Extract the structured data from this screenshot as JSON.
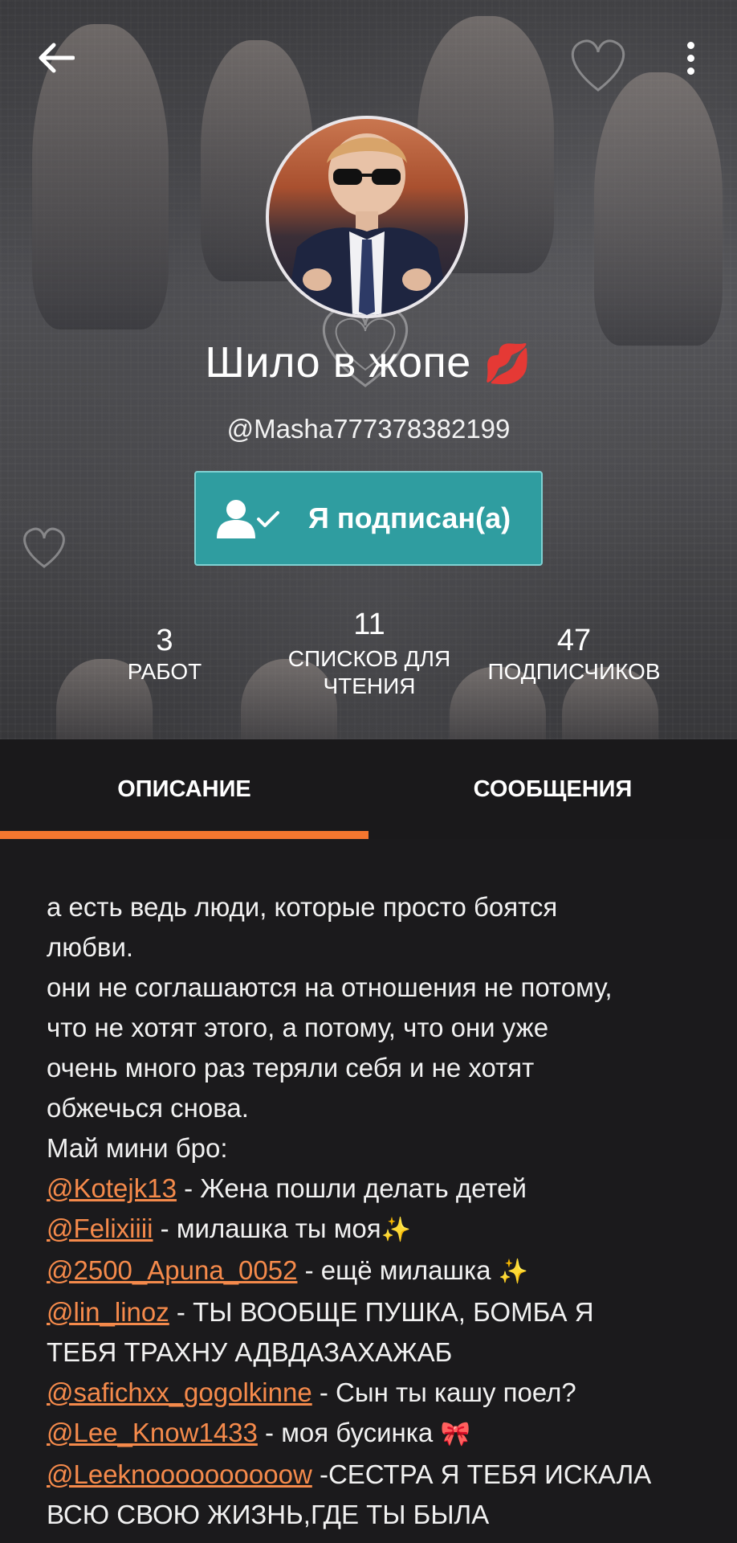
{
  "header": {
    "back_icon": "arrow-left-icon",
    "menu_icon": "more-vertical-icon"
  },
  "profile": {
    "name": "Шило в жопе",
    "name_emoji": "💋",
    "handle": "@Masha777378382199",
    "follow_button_label": "Я подписан(а)",
    "follow_icon": "user-check-icon"
  },
  "stats": [
    {
      "value": "3",
      "label": "РАБОТ"
    },
    {
      "value": "11",
      "label_line1": "СПИСКОВ ДЛЯ",
      "label_line2": "ЧТЕНИЯ"
    },
    {
      "value": "47",
      "label": "ПОДПИСЧИКОВ"
    }
  ],
  "tabs": [
    {
      "label": "ОПИСАНИЕ",
      "active": true
    },
    {
      "label": "СООБЩЕНИЯ",
      "active": false
    }
  ],
  "colors": {
    "accent": "#f4762f",
    "follow_button": "#2f9da0",
    "background": "#1b1a1c",
    "mention": "#f58a4b"
  },
  "description": {
    "intro_lines": [
      "а есть ведь люди, которые просто боятся",
      "любви.",
      "они не соглашаются на отношения не потому,",
      "что не хотят этого, а потому, что они уже",
      "очень много раз теряли себя и не хотят",
      "обжечься снова.",
      "Май мини бро:"
    ],
    "mentions": [
      {
        "handle": "@Kotejk13",
        "text": " - Жена пошли делать детей",
        "emoji": ""
      },
      {
        "handle": "@Felixiiii",
        "text": " - милашка ты моя",
        "emoji": "✨"
      },
      {
        "handle": "@2500_Apuna_0052",
        "text": " - ещё милашка ",
        "emoji": "✨"
      },
      {
        "handle": "@lin_linoz",
        "text": " - ТЫ ВООБЩЕ ПУШКА, БОМБА Я",
        "cont": "ТЕБЯ ТРАХНУ АДВДАЗАХАЖАБ",
        "emoji": ""
      },
      {
        "handle": "@safichxx_gogolkinne",
        "text": " - Сын ты кашу поел?",
        "emoji": ""
      },
      {
        "handle": "@Lee_Know1433",
        "text": " - моя бусинка ",
        "emoji": "🎀"
      },
      {
        "handle": "@Leeknoooooooooow",
        "text": " -СЕСТРА Я ТЕБЯ ИСКАЛА",
        "cont": "ВСЮ СВОЮ ЖИЗНЬ,ГДЕ ТЫ БЫЛА",
        "emoji": ""
      }
    ]
  }
}
